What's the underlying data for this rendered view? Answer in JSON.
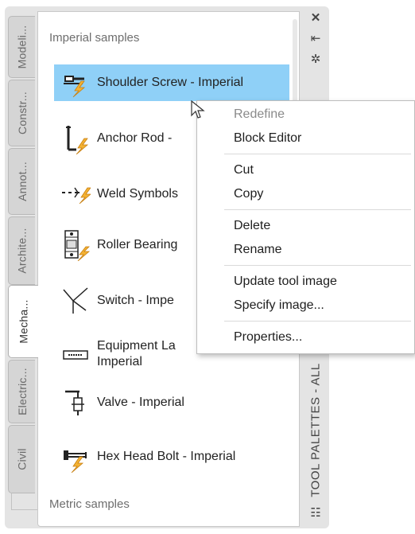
{
  "tabs": [
    {
      "label": "Modeli..."
    },
    {
      "label": "Constr..."
    },
    {
      "label": "Annot..."
    },
    {
      "label": "Archite..."
    },
    {
      "label": "Mecha..."
    },
    {
      "label": "Electric..."
    },
    {
      "label": "Civil"
    }
  ],
  "active_tab_index": 4,
  "sections": {
    "imperial_title": "Imperial samples",
    "metric_title": "Metric samples"
  },
  "tools": [
    {
      "label": "Shoulder Screw - Imperial",
      "icon": "shoulder-screw-icon"
    },
    {
      "label": "Anchor Rod -",
      "icon": "anchor-rod-icon"
    },
    {
      "label": "Weld Symbols",
      "icon": "weld-symbol-icon"
    },
    {
      "label": "Roller Bearing",
      "icon": "roller-bearing-icon"
    },
    {
      "label": "Switch - Impe",
      "icon": "switch-icon"
    },
    {
      "label": "Equipment La",
      "label2": "Imperial",
      "icon": "equipment-label-icon"
    },
    {
      "label": "Valve - Imperial",
      "icon": "valve-icon"
    },
    {
      "label": "Hex Head Bolt - Imperial",
      "icon": "hex-bolt-icon"
    }
  ],
  "right_strip": {
    "title": "TOOL PALETTES - ALL",
    "close_glyph": "✕",
    "autohide_glyph": "⇤",
    "properties_glyph": "✲",
    "bottom_glyph": "☷"
  },
  "context_menu": {
    "items": [
      {
        "label": "Redefine",
        "disabled": true
      },
      {
        "label": "Block Editor",
        "disabled": false
      },
      {
        "label": "Cut",
        "disabled": false
      },
      {
        "label": "Copy",
        "disabled": false
      },
      {
        "label": "Delete",
        "disabled": false
      },
      {
        "label": "Rename",
        "disabled": false
      },
      {
        "label": "Update tool image",
        "disabled": false
      },
      {
        "label": "Specify image...",
        "disabled": false
      },
      {
        "label": "Properties...",
        "disabled": false
      }
    ]
  },
  "colors": {
    "selection": "#8fd0f7",
    "lightning": "#f4b233"
  }
}
